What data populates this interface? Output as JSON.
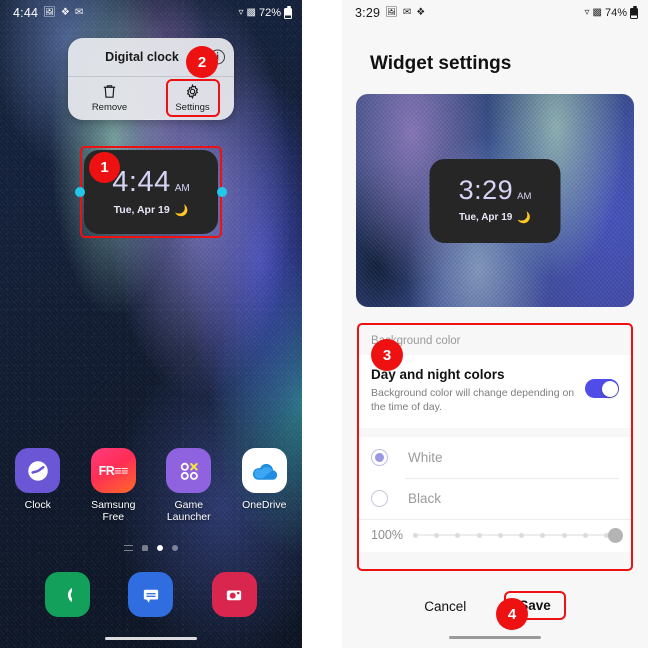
{
  "left_phone": {
    "status_bar": {
      "time": "4:44",
      "icons": [
        "image-icon",
        "bluetooth-share-icon",
        "messages-icon"
      ],
      "wifi_icon": "wifi-icon",
      "signal_icon": "signal-bars-icon",
      "battery_text": "72%"
    },
    "popup": {
      "title": "Digital clock",
      "info_icon": "info-icon",
      "actions": [
        {
          "label": "Remove",
          "icon": "trash-icon"
        },
        {
          "label": "Settings",
          "icon": "gear-icon"
        }
      ]
    },
    "widget": {
      "time": "4:44",
      "ampm": "AM",
      "date": "Tue, Apr 19",
      "moon_icon": "crescent-moon-icon"
    },
    "apps": [
      {
        "label": "Clock",
        "icon": "clock-app-icon"
      },
      {
        "label": "Samsung Free",
        "icon": "samsung-free-app-icon",
        "glyph": "FREE"
      },
      {
        "label": "Game Launcher",
        "icon": "game-launcher-app-icon"
      },
      {
        "label": "OneDrive",
        "icon": "onedrive-app-icon"
      }
    ],
    "page_dots": {
      "count": 4,
      "active_index": 2
    },
    "dock": [
      {
        "icon": "phone-icon"
      },
      {
        "icon": "messages-icon"
      },
      {
        "icon": "camera-icon"
      }
    ]
  },
  "right_phone": {
    "status_bar": {
      "time": "3:29",
      "icons": [
        "image-icon",
        "messages-icon",
        "bluetooth-share-icon"
      ],
      "wifi_icon": "wifi-icon",
      "signal_icon": "signal-bars-icon",
      "battery_text": "74%"
    },
    "title": "Widget settings",
    "preview": {
      "time": "3:29",
      "ampm": "AM",
      "date": "Tue, Apr 19",
      "moon_icon": "crescent-moon-icon"
    },
    "settings": {
      "section_label": "Background color",
      "day_night": {
        "title": "Day and night colors",
        "description": "Background color will change depending on the time of day.",
        "toggle_on": true
      },
      "color_options": [
        {
          "label": "White",
          "selected": true
        },
        {
          "label": "Black",
          "selected": false
        }
      ],
      "opacity": {
        "value_label": "100%",
        "percent": 100,
        "tick_count": 10
      }
    },
    "footer": {
      "cancel_label": "Cancel",
      "save_label": "Save"
    }
  },
  "annotations": {
    "badge1": "1",
    "badge2": "2",
    "badge3": "3",
    "badge4": "4",
    "accent_color": "#ee1111"
  }
}
